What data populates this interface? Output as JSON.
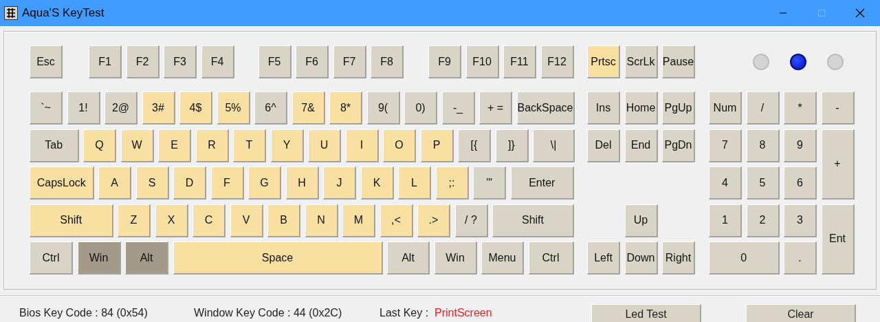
{
  "window": {
    "title": "Aqua'S KeyTest"
  },
  "keyboard": {
    "function_row": [
      {
        "label": "Esc",
        "tested": false,
        "held": false
      },
      {
        "label": "F1",
        "tested": false,
        "held": false
      },
      {
        "label": "F2",
        "tested": false,
        "held": false
      },
      {
        "label": "F3",
        "tested": false,
        "held": false
      },
      {
        "label": "F4",
        "tested": false,
        "held": false
      },
      {
        "label": "F5",
        "tested": false,
        "held": false
      },
      {
        "label": "F6",
        "tested": false,
        "held": false
      },
      {
        "label": "F7",
        "tested": false,
        "held": false
      },
      {
        "label": "F8",
        "tested": false,
        "held": false
      },
      {
        "label": "F9",
        "tested": false,
        "held": false
      },
      {
        "label": "F10",
        "tested": false,
        "held": false
      },
      {
        "label": "F11",
        "tested": false,
        "held": false
      },
      {
        "label": "F12",
        "tested": false,
        "held": false
      }
    ],
    "main_rows": [
      [
        {
          "label": "`~",
          "tested": false,
          "held": false
        },
        {
          "label": "1!",
          "tested": false,
          "held": false
        },
        {
          "label": "2@",
          "tested": false,
          "held": false
        },
        {
          "label": "3#",
          "tested": true,
          "held": false
        },
        {
          "label": "4$",
          "tested": true,
          "held": false
        },
        {
          "label": "5%",
          "tested": true,
          "held": false
        },
        {
          "label": "6^",
          "tested": false,
          "held": false
        },
        {
          "label": "7&",
          "tested": true,
          "held": false
        },
        {
          "label": "8*",
          "tested": true,
          "held": false
        },
        {
          "label": "9(",
          "tested": false,
          "held": false
        },
        {
          "label": "0)",
          "tested": false,
          "held": false
        },
        {
          "label": "-_",
          "tested": false,
          "held": false
        },
        {
          "label": "+ =",
          "tested": false,
          "held": false
        },
        {
          "label": "BackSpace",
          "tested": false,
          "held": false
        }
      ],
      [
        {
          "label": "Tab",
          "tested": false,
          "held": false
        },
        {
          "label": "Q",
          "tested": true,
          "held": false
        },
        {
          "label": "W",
          "tested": true,
          "held": false
        },
        {
          "label": "E",
          "tested": true,
          "held": false
        },
        {
          "label": "R",
          "tested": true,
          "held": false
        },
        {
          "label": "T",
          "tested": true,
          "held": false
        },
        {
          "label": "Y",
          "tested": true,
          "held": false
        },
        {
          "label": "U",
          "tested": true,
          "held": false
        },
        {
          "label": "I",
          "tested": true,
          "held": false
        },
        {
          "label": "O",
          "tested": true,
          "held": false
        },
        {
          "label": "P",
          "tested": true,
          "held": false
        },
        {
          "label": "[{",
          "tested": false,
          "held": false
        },
        {
          "label": "]}",
          "tested": false,
          "held": false
        },
        {
          "label": "\\|",
          "tested": false,
          "held": false
        }
      ],
      [
        {
          "label": "CapsLock",
          "tested": true,
          "held": false
        },
        {
          "label": "A",
          "tested": true,
          "held": false
        },
        {
          "label": "S",
          "tested": true,
          "held": false
        },
        {
          "label": "D",
          "tested": true,
          "held": false
        },
        {
          "label": "F",
          "tested": true,
          "held": false
        },
        {
          "label": "G",
          "tested": true,
          "held": false
        },
        {
          "label": "H",
          "tested": true,
          "held": false
        },
        {
          "label": "J",
          "tested": true,
          "held": false
        },
        {
          "label": "K",
          "tested": true,
          "held": false
        },
        {
          "label": "L",
          "tested": true,
          "held": false
        },
        {
          "label": ";:",
          "tested": true,
          "held": false
        },
        {
          "label": "'\"",
          "tested": false,
          "held": false
        },
        {
          "label": "Enter",
          "tested": false,
          "held": false
        }
      ],
      [
        {
          "label": "Shift",
          "tested": true,
          "held": false
        },
        {
          "label": "Z",
          "tested": true,
          "held": false
        },
        {
          "label": "X",
          "tested": true,
          "held": false
        },
        {
          "label": "C",
          "tested": true,
          "held": false
        },
        {
          "label": "V",
          "tested": true,
          "held": false
        },
        {
          "label": "B",
          "tested": true,
          "held": false
        },
        {
          "label": "N",
          "tested": true,
          "held": false
        },
        {
          "label": "M",
          "tested": true,
          "held": false
        },
        {
          "label": ",<",
          "tested": true,
          "held": false
        },
        {
          "label": ".>",
          "tested": true,
          "held": false
        },
        {
          "label": "/ ?",
          "tested": false,
          "held": false
        },
        {
          "label": "Shift",
          "tested": false,
          "held": false
        }
      ],
      [
        {
          "label": "Ctrl",
          "tested": false,
          "held": false
        },
        {
          "label": "Win",
          "tested": false,
          "held": true
        },
        {
          "label": "Alt",
          "tested": false,
          "held": true
        },
        {
          "label": "Space",
          "tested": true,
          "held": false
        },
        {
          "label": "Alt",
          "tested": false,
          "held": false
        },
        {
          "label": "Win",
          "tested": false,
          "held": false
        },
        {
          "label": "Menu",
          "tested": false,
          "held": false
        },
        {
          "label": "Ctrl",
          "tested": false,
          "held": false
        }
      ]
    ],
    "nav_top": [
      {
        "label": "Prtsc",
        "tested": true,
        "held": false
      },
      {
        "label": "ScrLk",
        "tested": false,
        "held": false
      },
      {
        "label": "Pause",
        "tested": false,
        "held": false
      }
    ],
    "nav_rows": [
      [
        {
          "label": "Ins",
          "tested": false,
          "held": false
        },
        {
          "label": "Home",
          "tested": false,
          "held": false
        },
        {
          "label": "PgUp",
          "tested": false,
          "held": false
        }
      ],
      [
        {
          "label": "Del",
          "tested": false,
          "held": false
        },
        {
          "label": "End",
          "tested": false,
          "held": false
        },
        {
          "label": "PgDn",
          "tested": false,
          "held": false
        }
      ],
      [],
      [
        {
          "label": "Up",
          "tested": false,
          "held": false
        }
      ],
      [
        {
          "label": "Left",
          "tested": false,
          "held": false
        },
        {
          "label": "Down",
          "tested": false,
          "held": false
        },
        {
          "label": "Right",
          "tested": false,
          "held": false
        }
      ]
    ],
    "leds": [
      {
        "on": false
      },
      {
        "on": true
      },
      {
        "on": false
      }
    ],
    "numpad": [
      {
        "label": "Num",
        "tested": false,
        "held": false
      },
      {
        "label": "/",
        "tested": false,
        "held": false
      },
      {
        "label": "*",
        "tested": false,
        "held": false
      },
      {
        "label": "-",
        "tested": false,
        "held": false
      },
      {
        "label": "7",
        "tested": false,
        "held": false
      },
      {
        "label": "8",
        "tested": false,
        "held": false
      },
      {
        "label": "9",
        "tested": false,
        "held": false
      },
      {
        "label": "+",
        "tested": false,
        "held": false
      },
      {
        "label": "4",
        "tested": false,
        "held": false
      },
      {
        "label": "5",
        "tested": false,
        "held": false
      },
      {
        "label": "6",
        "tested": false,
        "held": false
      },
      {
        "label": "1",
        "tested": false,
        "held": false
      },
      {
        "label": "2",
        "tested": false,
        "held": false
      },
      {
        "label": "3",
        "tested": false,
        "held": false
      },
      {
        "label": "Ent",
        "tested": false,
        "held": false
      },
      {
        "label": "0",
        "tested": false,
        "held": false
      },
      {
        "label": ".",
        "tested": false,
        "held": false
      }
    ]
  },
  "status_bar": {
    "bios_code": "Bios Key Code : 84 (0x54)",
    "window_code": "Window Key Code : 44 (0x2C)",
    "last_key_label": "Last Key :",
    "last_key": "PrintScreen"
  },
  "buttons": [
    "Led Test",
    "Clear"
  ]
}
